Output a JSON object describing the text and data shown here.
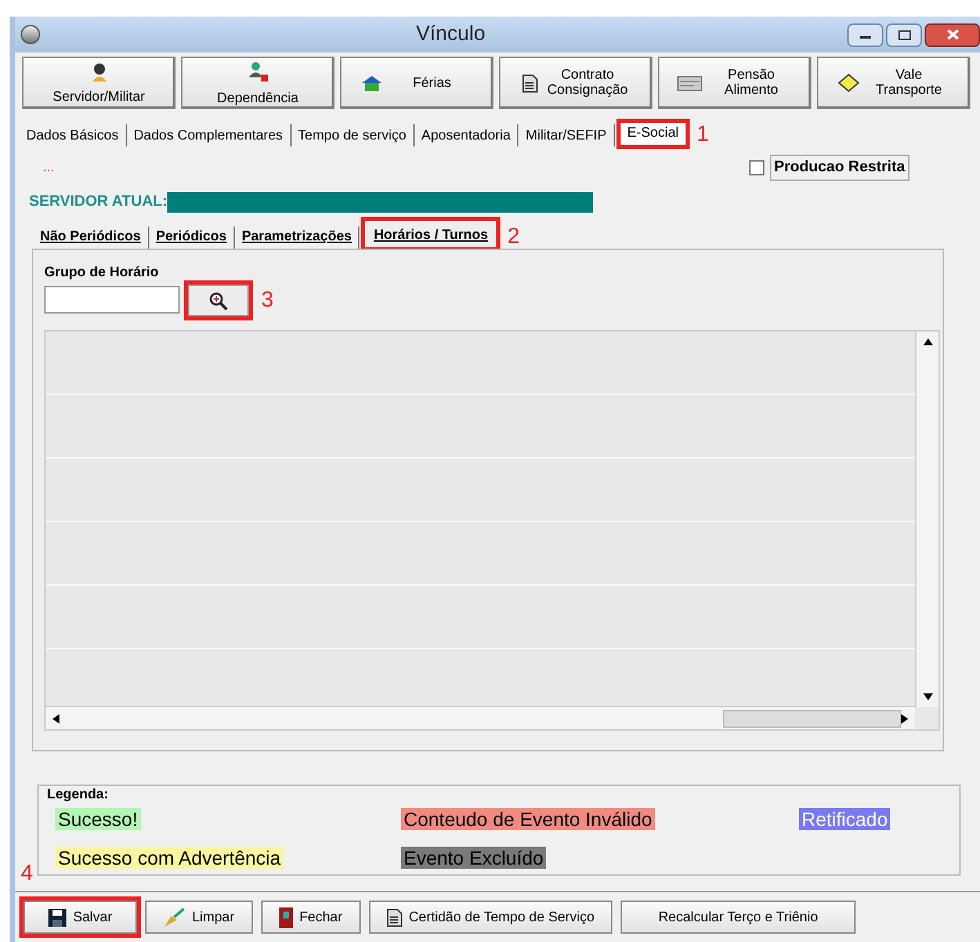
{
  "window": {
    "title": "Vínculo"
  },
  "toolbar": [
    {
      "label": "Servidor/Militar"
    },
    {
      "label": "Dependência"
    },
    {
      "label": "Férias"
    },
    {
      "label": "Contrato Consignação"
    },
    {
      "label": "Pensão Alimento"
    },
    {
      "label": "Vale Transporte"
    }
  ],
  "tabs": [
    {
      "label": "Dados Básicos",
      "selected": false
    },
    {
      "label": "Dados Complementares",
      "selected": false
    },
    {
      "label": "Tempo de serviço",
      "selected": false
    },
    {
      "label": "Aposentadoria",
      "selected": false
    },
    {
      "label": "Militar/SEFIP",
      "selected": false
    },
    {
      "label": "E-Social",
      "selected": true,
      "callout": "1"
    }
  ],
  "ellipsis": "...",
  "restricted": {
    "label": "Producao Restrita",
    "checked": false
  },
  "current_server": {
    "label": "SERVIDOR ATUAL:"
  },
  "subtabs": [
    {
      "label": "Não Periódicos",
      "selected": false
    },
    {
      "label": "Periódicos",
      "selected": false
    },
    {
      "label": "Parametrizações",
      "selected": false
    },
    {
      "label": "Horários / Turnos",
      "selected": true,
      "callout": "2"
    }
  ],
  "schedule_group": {
    "label": "Grupo de Horário",
    "search_callout": "3"
  },
  "legend": {
    "title": "Legenda:",
    "items": [
      {
        "label": "Sucesso!",
        "color": "#b3f5b3"
      },
      {
        "label": "Conteudo de Evento Inválido",
        "color": "#f28a80"
      },
      {
        "label": "Retificado",
        "color": "#7a7af0"
      },
      {
        "label": "Sucesso com Advertência",
        "color": "#faf5a0"
      },
      {
        "label": "Evento Excluído",
        "color": "#7a7a7a"
      }
    ]
  },
  "bottom_buttons": [
    {
      "label": "Salvar",
      "callout": "4"
    },
    {
      "label": "Limpar"
    },
    {
      "label": "Fechar"
    },
    {
      "label": "Certidão de Tempo de Serviço"
    },
    {
      "label": "Recalcular Terço e Triênio"
    }
  ]
}
